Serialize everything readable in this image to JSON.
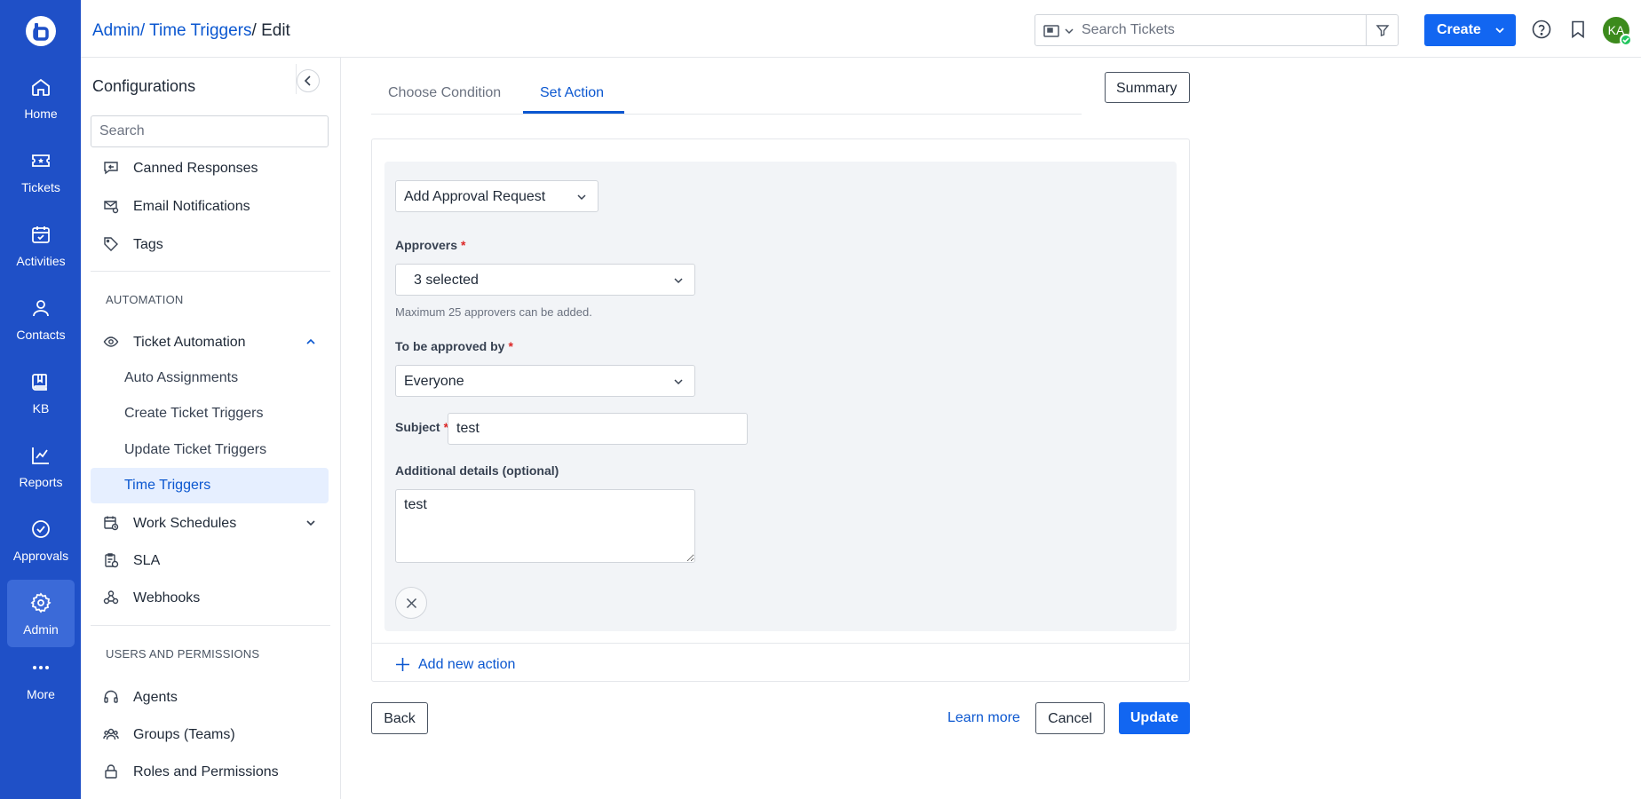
{
  "rail": {
    "items": [
      {
        "label": "Home",
        "icon": "home-icon"
      },
      {
        "label": "Tickets",
        "icon": "ticket-icon"
      },
      {
        "label": "Activities",
        "icon": "calendar-check-icon"
      },
      {
        "label": "Contacts",
        "icon": "person-icon"
      },
      {
        "label": "KB",
        "icon": "book-icon"
      },
      {
        "label": "Reports",
        "icon": "line-chart-icon"
      },
      {
        "label": "Approvals",
        "icon": "check-circle-icon"
      },
      {
        "label": "Admin",
        "icon": "gear-icon"
      },
      {
        "label": "More",
        "icon": "more-dots-icon"
      }
    ],
    "active": "Admin",
    "color": "#1f50c7"
  },
  "header": {
    "breadcrumb": {
      "part1": "Admin",
      "part2": "Time Triggers",
      "current": "Edit"
    },
    "search_placeholder": "Search Tickets",
    "create_label": "Create",
    "avatar_initials": "KA"
  },
  "config": {
    "title": "Configurations",
    "search_placeholder": "Search",
    "top_items": [
      {
        "label": "Canned Responses",
        "icon": "chat-reply-icon"
      },
      {
        "label": "Email Notifications",
        "icon": "email-bell-icon"
      },
      {
        "label": "Tags",
        "icon": "tag-icon"
      }
    ],
    "automation_heading": "AUTOMATION",
    "ticket_automation": "Ticket Automation",
    "automation_sub": [
      "Auto Assignments",
      "Create Ticket Triggers",
      "Update Ticket Triggers",
      "Time Triggers"
    ],
    "work_schedules": "Work Schedules",
    "sla": "SLA",
    "webhooks": "Webhooks",
    "users_heading": "USERS AND PERMISSIONS",
    "users_items": [
      {
        "label": "Agents",
        "icon": "headset-icon"
      },
      {
        "label": "Groups (Teams)",
        "icon": "group-icon"
      },
      {
        "label": "Roles and Permissions",
        "icon": "lock-icon"
      }
    ]
  },
  "main": {
    "tabs": [
      "Choose Condition",
      "Set Action"
    ],
    "active_tab": "Set Action",
    "summary_label": "Summary",
    "action": {
      "type": "Add Approval Request",
      "approvers_label": "Approvers",
      "approvers_value": "3 selected",
      "approvers_hint": "Maximum 25 approvers can be added.",
      "approved_by_label": "To be approved by",
      "approved_by_value": "Everyone",
      "subject_label": "Subject",
      "subject_value": "test",
      "details_label": "Additional details (optional)",
      "details_value": "test"
    },
    "add_action_label": "Add new action",
    "back_label": "Back",
    "learn_more_label": "Learn more",
    "cancel_label": "Cancel",
    "update_label": "Update"
  },
  "colors": {
    "primary": "#1266f1",
    "link": "#0b57d0",
    "required": "#dc2626"
  }
}
